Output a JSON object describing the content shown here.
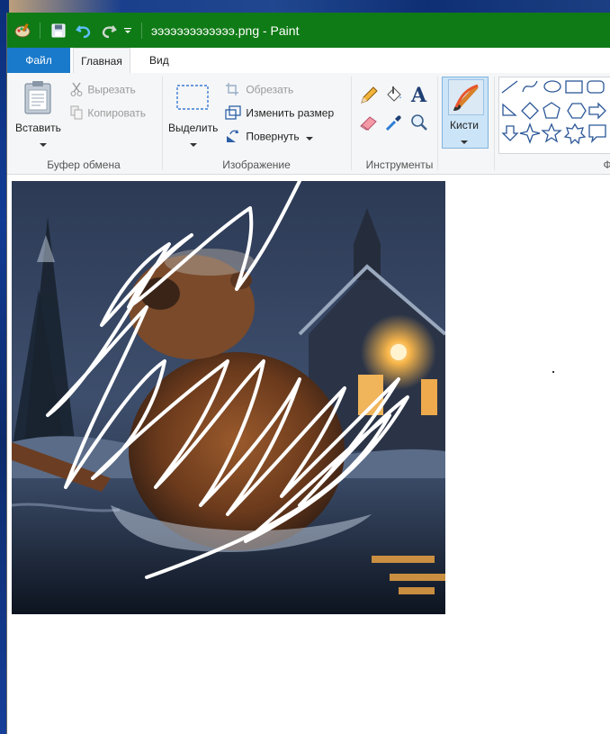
{
  "window": {
    "title": "эээээээээээээ.png - Paint"
  },
  "tabs": {
    "file": "Файл",
    "home": "Главная",
    "view": "Вид"
  },
  "clipboard": {
    "paste": "Вставить",
    "cut": "Вырезать",
    "copy": "Копировать",
    "label": "Буфер обмена"
  },
  "image_group": {
    "select": "Выделить",
    "crop": "Обрезать",
    "resize": "Изменить размер",
    "rotate": "Повернуть",
    "label": "Изображение"
  },
  "tools": {
    "label": "Инструменты"
  },
  "brushes": {
    "label": "Кисти"
  },
  "shapes": {
    "label_partial": "Ф"
  },
  "colors": {
    "accent": "#0f7b16",
    "file_tab": "#1979ca",
    "ribbon_bg": "#f5f6f7"
  },
  "icons": [
    "paint-logo-icon",
    "save-icon",
    "undo-icon",
    "redo-icon",
    "customize-qat-icon",
    "paste-icon",
    "cut-icon",
    "copy-icon",
    "select-icon",
    "crop-icon",
    "resize-icon",
    "rotate-icon",
    "pencil-icon",
    "fill-icon",
    "text-icon",
    "eraser-icon",
    "color-picker-icon",
    "magnifier-icon",
    "brush-icon"
  ]
}
